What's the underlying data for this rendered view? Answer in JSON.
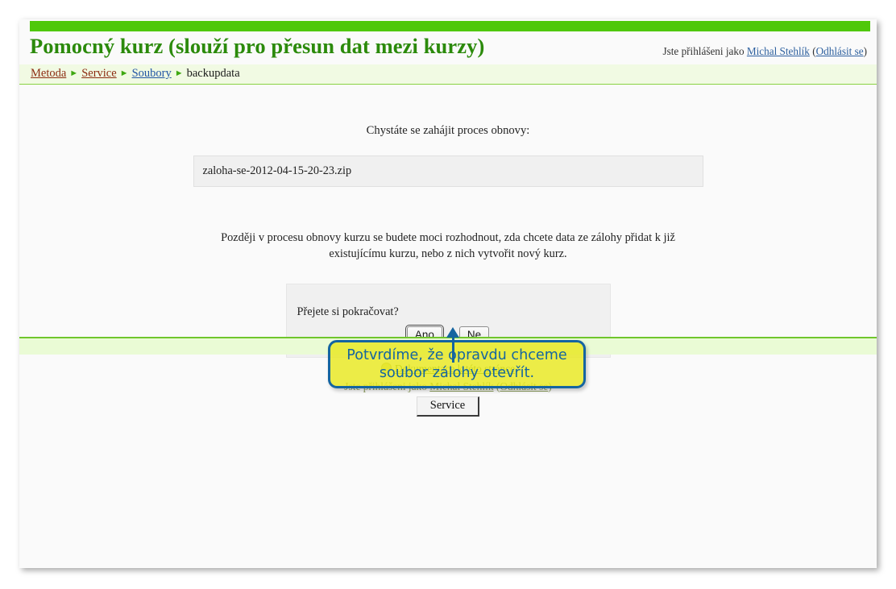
{
  "header": {
    "title": "Pomocný kurz (slouží pro přesun dat mezi kurzy)",
    "login_prefix": "Jste přihlášeni jako ",
    "login_user": "Michal Stehlík",
    "login_open_paren": " (",
    "logout_label": "Odhlásit se",
    "login_close_paren": ")"
  },
  "breadcrumb": {
    "sep": "►",
    "items": [
      {
        "label": "Metoda",
        "link": true,
        "color": "red"
      },
      {
        "label": "Service",
        "link": true,
        "color": "red"
      },
      {
        "label": "Soubory",
        "link": true,
        "color": "blue"
      },
      {
        "label": "backupdata",
        "link": false,
        "color": "plain"
      }
    ]
  },
  "main": {
    "restore_heading": "Chystáte se zahájit proces obnovy:",
    "filename": "zaloha-se-2012-04-15-20-23.zip",
    "restore_description": "Později v procesu obnovy kurzu se budete moci rozhodnout, zda chcete data ze zálohy přidat k již existujícímu kurzu, nebo z nich vytvořit nový kurz.",
    "confirm_question": "Přejete si pokračovat?",
    "confirm_yes": "Ano",
    "confirm_no": "Ne"
  },
  "footer": {
    "doc_link": "Dokumentace k této stránce",
    "login_prefix": "Jste přihlášeni jako ",
    "login_user": "Michal Stehlík",
    "login_open_paren": " (",
    "logout_label": "Odhlásit se",
    "login_close_paren": ")",
    "service_button": "Service"
  },
  "annotation": {
    "text": "Potvrdíme, že opravdu chceme\nsoubor zálohy otevřít."
  },
  "colors": {
    "topbar_green": "#4fc80a",
    "title_green": "#2b8a0b",
    "breadcrumb_band": "#f1fae3",
    "footer_band": "#eafbd5",
    "annotation_yellow": "#e8e81a",
    "annotation_blue": "#1565a0",
    "link_blue": "#2c5f9e",
    "link_red": "#8c2b10"
  }
}
